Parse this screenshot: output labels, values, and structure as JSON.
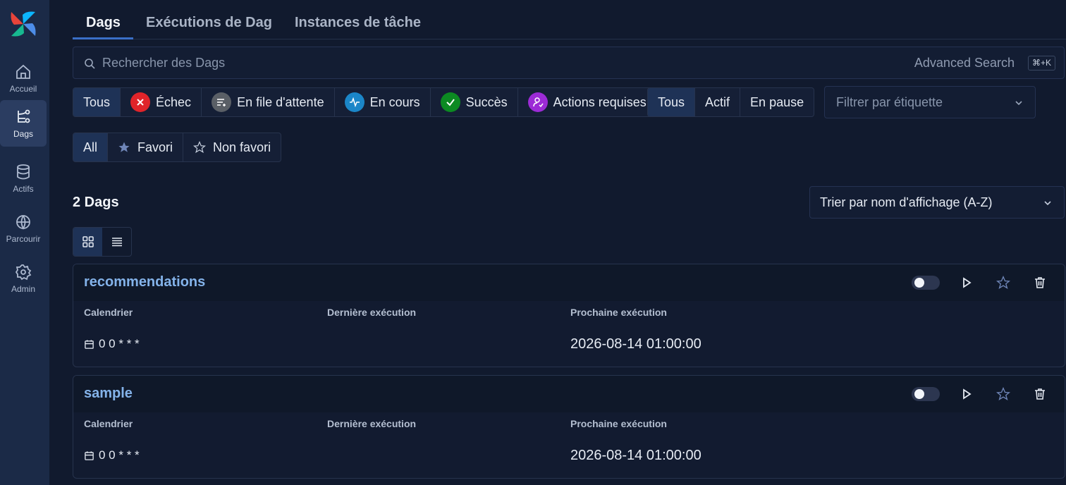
{
  "sidebar": {
    "items": [
      {
        "label": "Accueil",
        "icon": "home-icon"
      },
      {
        "label": "Dags",
        "icon": "dags-icon",
        "active": true
      },
      {
        "label": "Actifs",
        "icon": "database-icon"
      },
      {
        "label": "Parcourir",
        "icon": "globe-icon"
      },
      {
        "label": "Admin",
        "icon": "gear-icon"
      }
    ]
  },
  "tabs": [
    {
      "label": "Dags",
      "active": true
    },
    {
      "label": "Exécutions de Dag"
    },
    {
      "label": "Instances de tâche"
    }
  ],
  "search": {
    "placeholder": "Rechercher des Dags",
    "advanced_label": "Advanced Search",
    "shortcut": "⌘+K"
  },
  "state_filters": [
    {
      "label": "Tous",
      "active": true
    },
    {
      "label": "Échec",
      "icon": "x-icon",
      "color": "#e0242a"
    },
    {
      "label": "En file d'attente",
      "icon": "queue-icon",
      "color": "#5a5f66"
    },
    {
      "label": "En cours",
      "icon": "heartbeat-icon",
      "color": "#1b86c8"
    },
    {
      "label": "Succès",
      "icon": "check-icon",
      "color": "#0c8a22"
    },
    {
      "label": "Actions requises",
      "icon": "user-action-icon",
      "color": "#9c2bd6"
    }
  ],
  "pause_filters": [
    {
      "label": "Tous",
      "active": true
    },
    {
      "label": "Actif"
    },
    {
      "label": "En pause"
    }
  ],
  "tag_filter": {
    "placeholder": "Filtrer par étiquette"
  },
  "favorite_filters": [
    {
      "label": "All",
      "active": true
    },
    {
      "label": "Favori",
      "icon": "star-filled-icon"
    },
    {
      "label": "Non favori",
      "icon": "star-outline-icon"
    }
  ],
  "dag_count": "2 Dags",
  "sort": {
    "value": "Trier par nom d'affichage (A-Z)"
  },
  "columns": {
    "schedule": "Calendrier",
    "last_run": "Dernière exécution",
    "next_run": "Prochaine exécution"
  },
  "dags": [
    {
      "name": "recommendations",
      "schedule": "0 0 * * *",
      "next_run": "2026-08-14 01:00:00"
    },
    {
      "name": "sample",
      "schedule": "0 0 * * *",
      "next_run": "2026-08-14 01:00:00"
    }
  ],
  "colors": {
    "accent": "#3a6fc7",
    "link": "#84b3ea",
    "background": "#111a2e",
    "sidebar": "#1b2a47"
  }
}
